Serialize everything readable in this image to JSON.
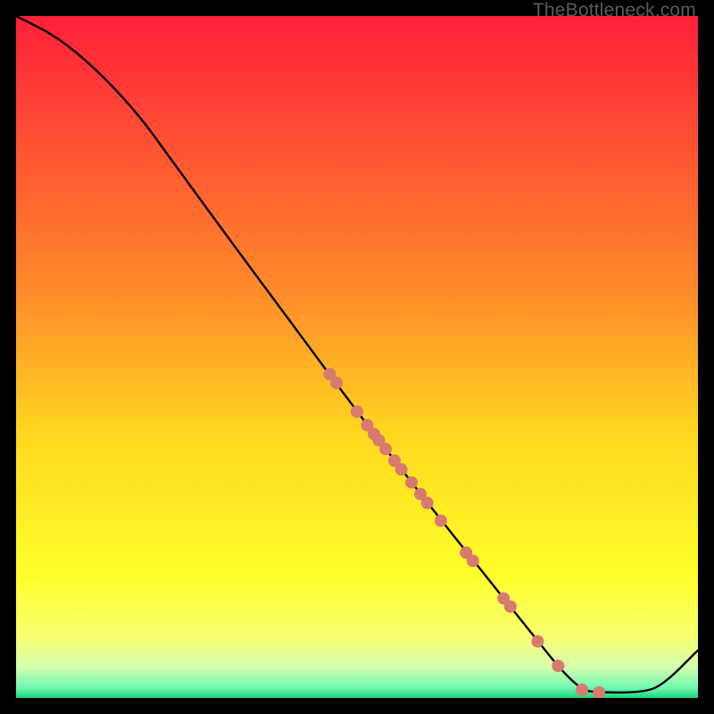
{
  "watermark": "TheBottleneck.com",
  "chart_data": {
    "type": "line",
    "title": "",
    "xlabel": "",
    "ylabel": "",
    "xlim": [
      0,
      100
    ],
    "ylim": [
      0,
      100
    ],
    "grid": false,
    "legend": false,
    "gradient_stops": [
      {
        "offset": 0,
        "color": "#ff1f3a"
      },
      {
        "offset": 0.4,
        "color": "#ff8a2a"
      },
      {
        "offset": 0.62,
        "color": "#ffd91f"
      },
      {
        "offset": 0.82,
        "color": "#ffff2a"
      },
      {
        "offset": 0.91,
        "color": "#f8ff70"
      },
      {
        "offset": 0.955,
        "color": "#d4ffb0"
      },
      {
        "offset": 0.985,
        "color": "#70f8b0"
      },
      {
        "offset": 1.0,
        "color": "#18d978"
      }
    ],
    "curve": [
      {
        "x": 0,
        "y": 100
      },
      {
        "x": 6,
        "y": 97
      },
      {
        "x": 12,
        "y": 92
      },
      {
        "x": 18,
        "y": 85.5
      },
      {
        "x": 22,
        "y": 80
      },
      {
        "x": 30,
        "y": 69
      },
      {
        "x": 40,
        "y": 55.5
      },
      {
        "x": 50,
        "y": 42
      },
      {
        "x": 60,
        "y": 29
      },
      {
        "x": 70,
        "y": 16.5
      },
      {
        "x": 76,
        "y": 9
      },
      {
        "x": 80,
        "y": 4
      },
      {
        "x": 83,
        "y": 1.2
      },
      {
        "x": 85,
        "y": 0.8
      },
      {
        "x": 92,
        "y": 0.8
      },
      {
        "x": 95,
        "y": 2
      },
      {
        "x": 100,
        "y": 7
      }
    ],
    "markers": [
      {
        "x": 46.0,
        "y": 47.5
      },
      {
        "x": 47.0,
        "y": 46.2
      },
      {
        "x": 50.0,
        "y": 42.0
      },
      {
        "x": 51.5,
        "y": 40.0
      },
      {
        "x": 52.5,
        "y": 38.7
      },
      {
        "x": 53.2,
        "y": 37.8
      },
      {
        "x": 54.2,
        "y": 36.5
      },
      {
        "x": 55.5,
        "y": 34.8
      },
      {
        "x": 56.5,
        "y": 33.5
      },
      {
        "x": 58.0,
        "y": 31.6
      },
      {
        "x": 59.3,
        "y": 29.9
      },
      {
        "x": 60.3,
        "y": 28.6
      },
      {
        "x": 62.3,
        "y": 26.0
      },
      {
        "x": 66.0,
        "y": 21.3
      },
      {
        "x": 67.0,
        "y": 20.1
      },
      {
        "x": 71.5,
        "y": 14.6
      },
      {
        "x": 72.5,
        "y": 13.4
      },
      {
        "x": 76.5,
        "y": 8.3
      },
      {
        "x": 79.5,
        "y": 4.7
      },
      {
        "x": 83.0,
        "y": 1.2
      },
      {
        "x": 85.5,
        "y": 0.8
      }
    ],
    "marker_style": {
      "radius": 7,
      "fill": "#d87a70"
    }
  }
}
